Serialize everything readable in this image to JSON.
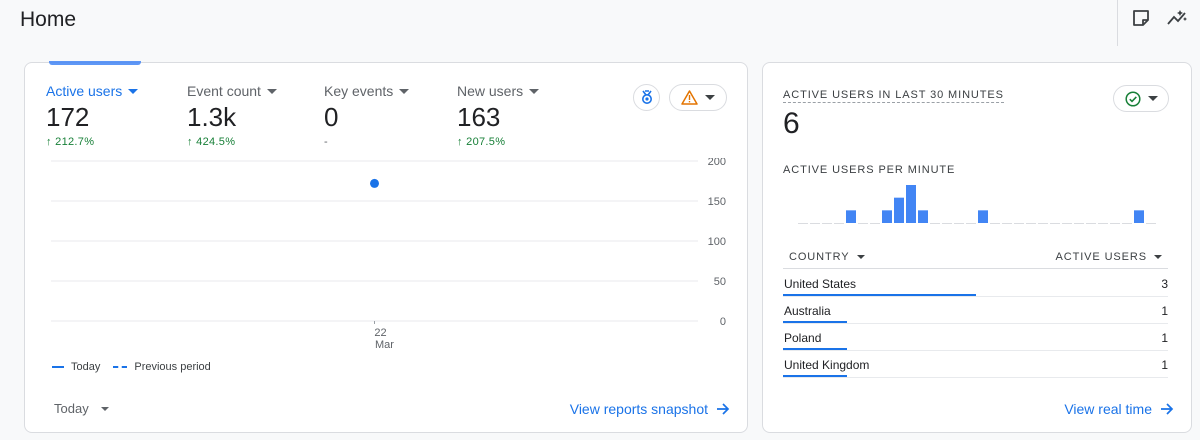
{
  "page": {
    "title": "Home"
  },
  "top_actions": [
    {
      "icon": "note-icon"
    },
    {
      "icon": "insights-icon"
    }
  ],
  "metrics": [
    {
      "label": "Active users",
      "value": "172",
      "change": "212.7%",
      "trend": "up",
      "active": true
    },
    {
      "label": "Event count",
      "value": "1.3k",
      "change": "424.5%",
      "trend": "up",
      "active": false
    },
    {
      "label": "Key events",
      "value": "0",
      "change": "-",
      "trend": "none",
      "active": false
    },
    {
      "label": "New users",
      "value": "163",
      "change": "207.5%",
      "trend": "up",
      "active": false
    }
  ],
  "chart_data": {
    "type": "line",
    "x": [
      "22\nMar"
    ],
    "x_tick_label_line1": "22",
    "x_tick_label_line2": "Mar",
    "series": [
      {
        "name": "Today",
        "values": [
          172
        ]
      },
      {
        "name": "Previous period",
        "values": [
          null
        ]
      }
    ],
    "yticks": [
      "200",
      "150",
      "100",
      "50",
      "0"
    ],
    "ylim": [
      0,
      200
    ],
    "grid": true,
    "legend_position": "bottom-left"
  },
  "legend": {
    "today": "Today",
    "previous": "Previous period"
  },
  "date_range": {
    "selected": "Today"
  },
  "links": {
    "snapshot": "View reports snapshot",
    "realtime": "View real time"
  },
  "realtime": {
    "title": "ACTIVE USERS IN LAST 30 MINUTES",
    "value": "6",
    "subtitle": "ACTIVE USERS PER MINUTE",
    "per_minute": [
      0,
      0,
      0,
      0,
      1,
      0,
      0,
      1,
      2,
      3,
      1,
      0,
      0,
      0,
      0,
      1,
      0,
      0,
      0,
      0,
      0,
      0,
      0,
      0,
      0,
      0,
      0,
      0,
      1,
      0
    ],
    "table": {
      "col_country": "COUNTRY",
      "col_users": "ACTIVE USERS",
      "rows": [
        {
          "country": "United States",
          "users": "3",
          "share": 0.5
        },
        {
          "country": "Australia",
          "users": "1",
          "share": 0.167
        },
        {
          "country": "Poland",
          "users": "1",
          "share": 0.167
        },
        {
          "country": "United Kingdom",
          "users": "1",
          "share": 0.167
        }
      ]
    }
  },
  "colors": {
    "accent": "#1a73e8",
    "positive": "#188038",
    "warning": "#e37400"
  }
}
